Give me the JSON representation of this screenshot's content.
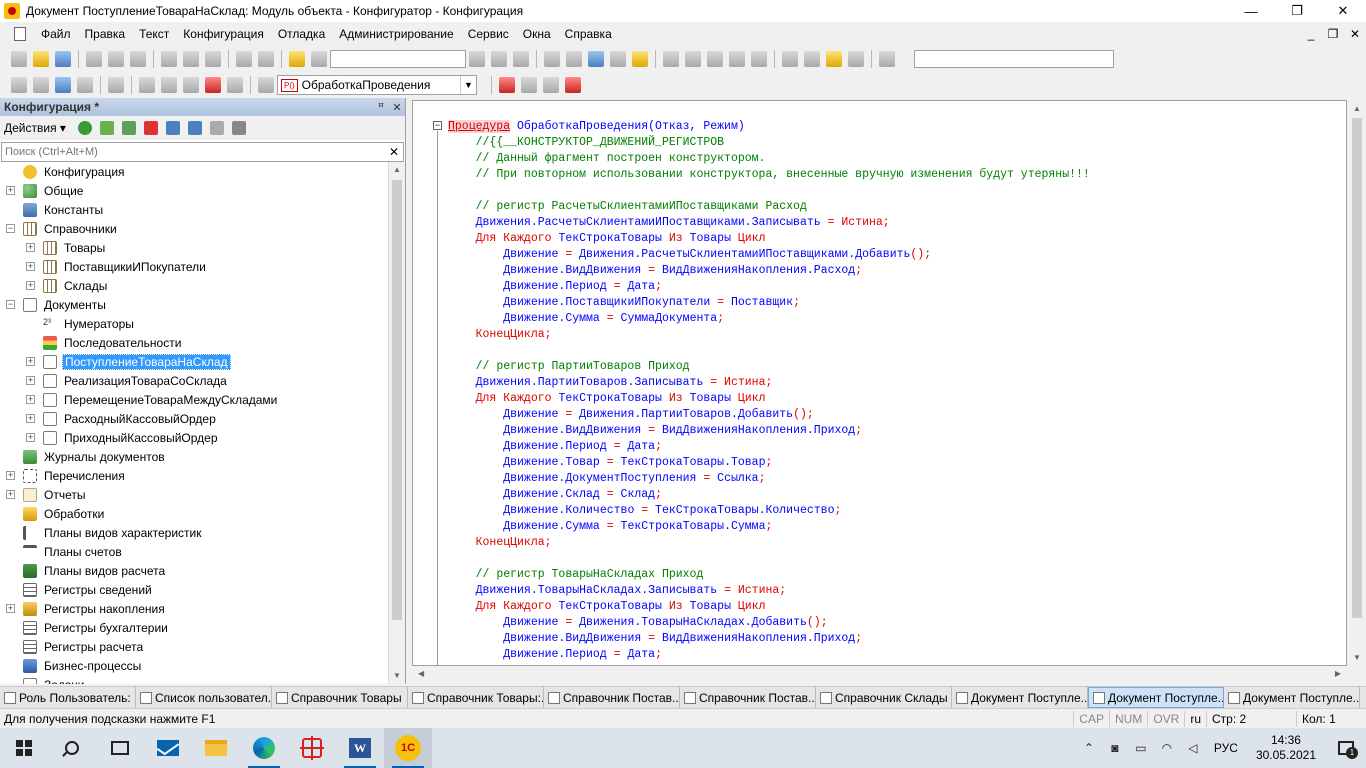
{
  "window": {
    "title": "Документ ПоступлениеТовараНаСклад: Модуль объекта - Конфигуратор - Конфигурация",
    "minimize": "—",
    "maximize": "❐",
    "close": "✕"
  },
  "menu": {
    "items": [
      "Файл",
      "Правка",
      "Текст",
      "Конфигурация",
      "Отладка",
      "Администрирование",
      "Сервис",
      "Окна",
      "Справка"
    ],
    "mdi_min": "_",
    "mdi_restore": "❐",
    "mdi_close": "✕"
  },
  "toolbar2": {
    "procedure_combo": "ОбработкаПроведения",
    "procedure_badge": "P()"
  },
  "left_panel": {
    "title": "Конфигурация *",
    "actions_label": "Действия",
    "search_placeholder": "Поиск (Ctrl+Alt+M)",
    "tree": [
      {
        "label": "Конфигурация",
        "level": 0,
        "expander": "",
        "icon": "config-icon",
        "cls": "folder-yellow"
      },
      {
        "label": "Общие",
        "level": 0,
        "expander": "+",
        "icon": "general-icon",
        "cls": "general"
      },
      {
        "label": "Константы",
        "level": 0,
        "expander": "",
        "icon": "constants-icon",
        "cls": "const"
      },
      {
        "label": "Справочники",
        "level": 0,
        "expander": "−",
        "icon": "catalogs-icon",
        "cls": "table"
      },
      {
        "label": "Товары",
        "level": 1,
        "expander": "+",
        "icon": "catalog-icon",
        "cls": "table"
      },
      {
        "label": "ПоставщикиИПокупатели",
        "level": 1,
        "expander": "+",
        "icon": "catalog-icon",
        "cls": "table"
      },
      {
        "label": "Склады",
        "level": 1,
        "expander": "+",
        "icon": "catalog-icon",
        "cls": "table"
      },
      {
        "label": "Документы",
        "level": 0,
        "expander": "−",
        "icon": "documents-icon",
        "cls": "doc"
      },
      {
        "label": "Нумераторы",
        "level": 1,
        "expander": "",
        "icon": "numerators-icon",
        "cls": "num"
      },
      {
        "label": "Последовательности",
        "level": 1,
        "expander": "",
        "icon": "sequences-icon",
        "cls": "seq"
      },
      {
        "label": "ПоступлениеТовараНаСклад",
        "level": 1,
        "expander": "+",
        "icon": "document-icon",
        "cls": "doc",
        "selected": true
      },
      {
        "label": "РеализацияТовараСоСклада",
        "level": 1,
        "expander": "+",
        "icon": "document-icon",
        "cls": "doc"
      },
      {
        "label": "ПеремещениеТовараМеждуСкладами",
        "level": 1,
        "expander": "+",
        "icon": "document-icon",
        "cls": "doc"
      },
      {
        "label": "РасходныйКассовыйОрдер",
        "level": 1,
        "expander": "+",
        "icon": "document-icon",
        "cls": "doc"
      },
      {
        "label": "ПриходныйКассовыйОрдер",
        "level": 1,
        "expander": "+",
        "icon": "document-icon",
        "cls": "doc"
      },
      {
        "label": "Журналы документов",
        "level": 0,
        "expander": "",
        "icon": "journals-icon",
        "cls": "journal"
      },
      {
        "label": "Перечисления",
        "level": 0,
        "expander": "+",
        "icon": "enums-icon",
        "cls": "enum"
      },
      {
        "label": "Отчеты",
        "level": 0,
        "expander": "+",
        "icon": "reports-icon",
        "cls": "report"
      },
      {
        "label": "Обработки",
        "level": 0,
        "expander": "",
        "icon": "data-processors-icon",
        "cls": "proc"
      },
      {
        "label": "Планы видов характеристик",
        "level": 0,
        "expander": "",
        "icon": "chart-of-characteristics-icon",
        "cls": "chars"
      },
      {
        "label": "Планы счетов",
        "level": 0,
        "expander": "",
        "icon": "chart-of-accounts-icon",
        "cls": "accts"
      },
      {
        "label": "Планы видов расчета",
        "level": 0,
        "expander": "",
        "icon": "chart-of-calculations-icon",
        "cls": "calc"
      },
      {
        "label": "Регистры сведений",
        "level": 0,
        "expander": "",
        "icon": "information-registers-icon",
        "cls": "reg"
      },
      {
        "label": "Регистры накопления",
        "level": 0,
        "expander": "+",
        "icon": "accumulation-registers-icon",
        "cls": "accum"
      },
      {
        "label": "Регистры бухгалтерии",
        "level": 0,
        "expander": "",
        "icon": "accounting-registers-icon",
        "cls": "reg"
      },
      {
        "label": "Регистры расчета",
        "level": 0,
        "expander": "",
        "icon": "calculation-registers-icon",
        "cls": "reg"
      },
      {
        "label": "Бизнес-процессы",
        "level": 0,
        "expander": "",
        "icon": "business-processes-icon",
        "cls": "bp"
      },
      {
        "label": "Задачи",
        "level": 0,
        "expander": "",
        "icon": "tasks-icon",
        "cls": "doc"
      }
    ]
  },
  "code_lines": [
    [
      [
        "proc-kw",
        "Процедура"
      ],
      [
        "id",
        " ОбработкаПроведения(Отказ, Режим)"
      ]
    ],
    [
      [
        "t",
        "    "
      ],
      [
        "cm",
        "//{{__КОНСТРУКТОР_ДВИЖЕНИЙ_РЕГИСТРОВ"
      ]
    ],
    [
      [
        "t",
        "    "
      ],
      [
        "cm",
        "// Данный фрагмент построен конструктором."
      ]
    ],
    [
      [
        "t",
        "    "
      ],
      [
        "cm",
        "// При повторном использовании конструктора, внесенные вручную изменения будут утеряны!!!"
      ]
    ],
    [],
    [
      [
        "t",
        "    "
      ],
      [
        "cm",
        "// регистр РасчетыСклиентамиИПоставщиками Расход"
      ]
    ],
    [
      [
        "t",
        "    "
      ],
      [
        "id",
        "Движения.РасчетыСклиентамиИПоставщиками.Записывать "
      ],
      [
        "op",
        "="
      ],
      [
        "kw",
        " Истина"
      ],
      [
        "op",
        ";"
      ]
    ],
    [
      [
        "t",
        "    "
      ],
      [
        "kw",
        "Для Каждого "
      ],
      [
        "id",
        "ТекСтрокаТовары "
      ],
      [
        "kw",
        "Из "
      ],
      [
        "id",
        "Товары "
      ],
      [
        "kw",
        "Цикл"
      ]
    ],
    [
      [
        "t",
        "        "
      ],
      [
        "id",
        "Движение "
      ],
      [
        "op",
        "="
      ],
      [
        "id",
        " Движения.РасчетыСклиентамиИПоставщиками.Добавить"
      ],
      [
        "op",
        "();"
      ]
    ],
    [
      [
        "t",
        "        "
      ],
      [
        "id",
        "Движение.ВидДвижения "
      ],
      [
        "op",
        "="
      ],
      [
        "id",
        " ВидДвиженияНакопления.Расход"
      ],
      [
        "op",
        ";"
      ]
    ],
    [
      [
        "t",
        "        "
      ],
      [
        "id",
        "Движение.Период "
      ],
      [
        "op",
        "="
      ],
      [
        "id",
        " Дата"
      ],
      [
        "op",
        ";"
      ]
    ],
    [
      [
        "t",
        "        "
      ],
      [
        "id",
        "Движение.ПоставщикиИПокупатели "
      ],
      [
        "op",
        "="
      ],
      [
        "id",
        " Поставщик"
      ],
      [
        "op",
        ";"
      ]
    ],
    [
      [
        "t",
        "        "
      ],
      [
        "id",
        "Движение.Сумма "
      ],
      [
        "op",
        "="
      ],
      [
        "id",
        " СуммаДокумента"
      ],
      [
        "op",
        ";"
      ]
    ],
    [
      [
        "t",
        "    "
      ],
      [
        "kw",
        "КонецЦикла"
      ],
      [
        "op",
        ";"
      ]
    ],
    [],
    [
      [
        "t",
        "    "
      ],
      [
        "cm",
        "// регистр ПартииТоваров Приход"
      ]
    ],
    [
      [
        "t",
        "    "
      ],
      [
        "id",
        "Движения.ПартииТоваров.Записывать "
      ],
      [
        "op",
        "="
      ],
      [
        "kw",
        " Истина"
      ],
      [
        "op",
        ";"
      ]
    ],
    [
      [
        "t",
        "    "
      ],
      [
        "kw",
        "Для Каждого "
      ],
      [
        "id",
        "ТекСтрокаТовары "
      ],
      [
        "kw",
        "Из "
      ],
      [
        "id",
        "Товары "
      ],
      [
        "kw",
        "Цикл"
      ]
    ],
    [
      [
        "t",
        "        "
      ],
      [
        "id",
        "Движение "
      ],
      [
        "op",
        "="
      ],
      [
        "id",
        " Движения.ПартииТоваров.Добавить"
      ],
      [
        "op",
        "();"
      ]
    ],
    [
      [
        "t",
        "        "
      ],
      [
        "id",
        "Движение.ВидДвижения "
      ],
      [
        "op",
        "="
      ],
      [
        "id",
        " ВидДвиженияНакопления.Приход"
      ],
      [
        "op",
        ";"
      ]
    ],
    [
      [
        "t",
        "        "
      ],
      [
        "id",
        "Движение.Период "
      ],
      [
        "op",
        "="
      ],
      [
        "id",
        " Дата"
      ],
      [
        "op",
        ";"
      ]
    ],
    [
      [
        "t",
        "        "
      ],
      [
        "id",
        "Движение.Товар "
      ],
      [
        "op",
        "="
      ],
      [
        "id",
        " ТекСтрокаТовары.Товар"
      ],
      [
        "op",
        ";"
      ]
    ],
    [
      [
        "t",
        "        "
      ],
      [
        "id",
        "Движение.ДокументПоступления "
      ],
      [
        "op",
        "="
      ],
      [
        "id",
        " Ссылка"
      ],
      [
        "op",
        ";"
      ]
    ],
    [
      [
        "t",
        "        "
      ],
      [
        "id",
        "Движение.Склад "
      ],
      [
        "op",
        "="
      ],
      [
        "id",
        " Склад"
      ],
      [
        "op",
        ";"
      ]
    ],
    [
      [
        "t",
        "        "
      ],
      [
        "id",
        "Движение.Количество "
      ],
      [
        "op",
        "="
      ],
      [
        "id",
        " ТекСтрокаТовары.Количество"
      ],
      [
        "op",
        ";"
      ]
    ],
    [
      [
        "t",
        "        "
      ],
      [
        "id",
        "Движение.Сумма "
      ],
      [
        "op",
        "="
      ],
      [
        "id",
        " ТекСтрокаТовары.Сумма"
      ],
      [
        "op",
        ";"
      ]
    ],
    [
      [
        "t",
        "    "
      ],
      [
        "kw",
        "КонецЦикла"
      ],
      [
        "op",
        ";"
      ]
    ],
    [],
    [
      [
        "t",
        "    "
      ],
      [
        "cm",
        "// регистр ТоварыНаСкладах Приход"
      ]
    ],
    [
      [
        "t",
        "    "
      ],
      [
        "id",
        "Движения.ТоварыНаСкладах.Записывать "
      ],
      [
        "op",
        "="
      ],
      [
        "kw",
        " Истина"
      ],
      [
        "op",
        ";"
      ]
    ],
    [
      [
        "t",
        "    "
      ],
      [
        "kw",
        "Для Каждого "
      ],
      [
        "id",
        "ТекСтрокаТовары "
      ],
      [
        "kw",
        "Из "
      ],
      [
        "id",
        "Товары "
      ],
      [
        "kw",
        "Цикл"
      ]
    ],
    [
      [
        "t",
        "        "
      ],
      [
        "id",
        "Движение "
      ],
      [
        "op",
        "="
      ],
      [
        "id",
        " Движения.ТоварыНаСкладах.Добавить"
      ],
      [
        "op",
        "();"
      ]
    ],
    [
      [
        "t",
        "        "
      ],
      [
        "id",
        "Движение.ВидДвижения "
      ],
      [
        "op",
        "="
      ],
      [
        "id",
        " ВидДвиженияНакопления.Приход"
      ],
      [
        "op",
        ";"
      ]
    ],
    [
      [
        "t",
        "        "
      ],
      [
        "id",
        "Движение.Период "
      ],
      [
        "op",
        "="
      ],
      [
        "id",
        " Дата"
      ],
      [
        "op",
        ";"
      ]
    ]
  ],
  "window_tabs": [
    {
      "label": "Роль Пользователь: ..."
    },
    {
      "label": "Список пользовател..."
    },
    {
      "label": "Справочник Товары"
    },
    {
      "label": "Справочник Товары:..."
    },
    {
      "label": "Справочник Постав..."
    },
    {
      "label": "Справочник Постав..."
    },
    {
      "label": "Справочник Склады"
    },
    {
      "label": "Документ Поступле..."
    },
    {
      "label": "Документ Поступле...",
      "active": true
    },
    {
      "label": "Документ Поступле..."
    }
  ],
  "status": {
    "hint": "Для получения подсказки нажмите F1",
    "cap": "CAP",
    "num": "NUM",
    "ovr": "OVR",
    "lang": "ru",
    "row": "Стр: 2",
    "col": "Кол: 1"
  },
  "taskbar": {
    "lang": "РУС",
    "time": "14:36",
    "date": "30.05.2021",
    "notifications": "1"
  }
}
